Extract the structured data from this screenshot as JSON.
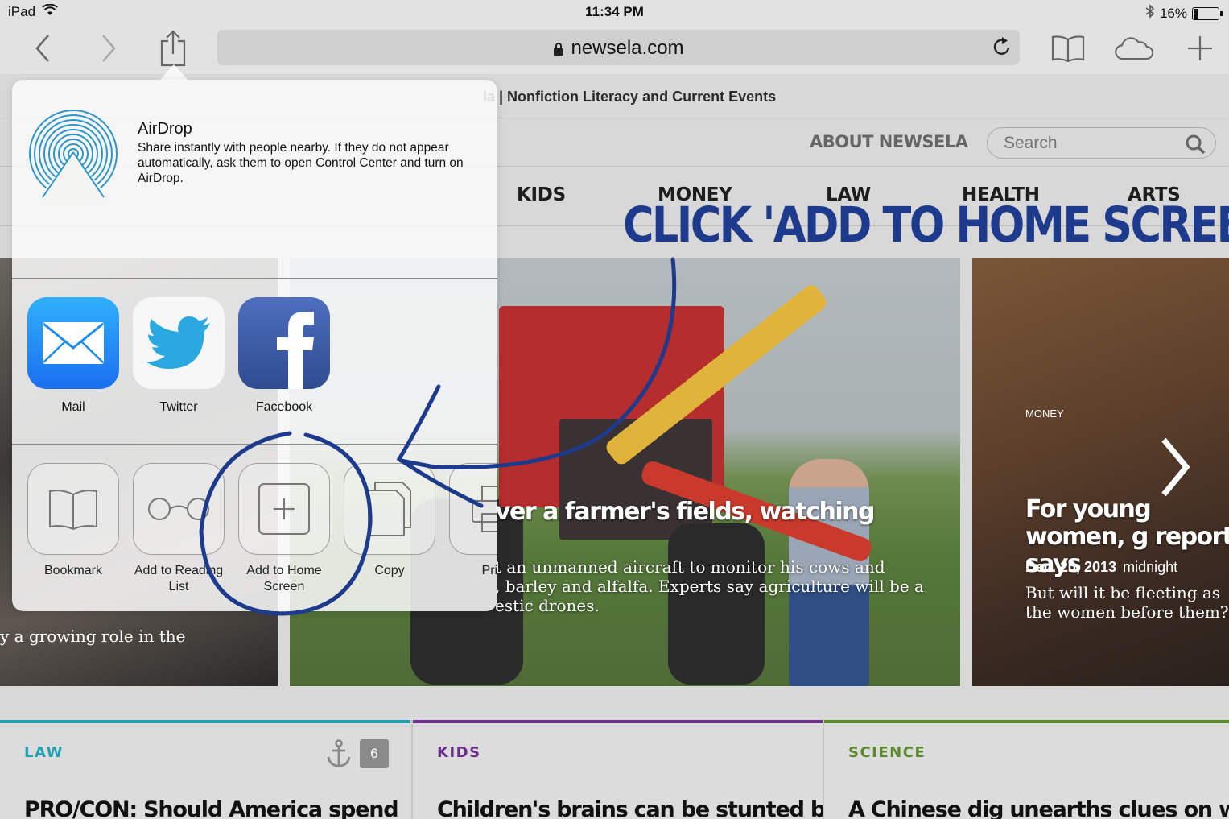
{
  "status_bar": {
    "device": "iPad",
    "time": "11:34 PM",
    "battery": "16%",
    "battery_level": 0.16
  },
  "browser": {
    "url": "newsela.com"
  },
  "page": {
    "title": "la | Nonfiction Literacy and Current Events",
    "about_link": "ABOUT NEWSELA",
    "search_placeholder": "Search",
    "nav": [
      "KIDS",
      "MONEY",
      "LAW",
      "HEALTH",
      "ARTS"
    ],
    "annotation": "CLICK 'ADD TO HOME SCREEN'",
    "hero_main": {
      "headline": "ver a farmer's fields, watching",
      "text_lines": [
        "t an unmanned aircraft to monitor his cows and",
        ", barley and alfalfa. Experts say agriculture will be a",
        "estic drones."
      ]
    },
    "hero_right": {
      "category": "MONEY",
      "headline": "For young women, g report says",
      "date": "Dec. 20, 2013",
      "time": "midnight",
      "text": "But will it be fleeting as the women before them?"
    },
    "hero_left_text": "y a growing role in the",
    "cards": [
      {
        "category": "LAW",
        "color": "#1fa3b2",
        "headline": "PRO/CON: Should America spend",
        "count": "6"
      },
      {
        "category": "KIDS",
        "color": "#6b2f8a",
        "headline": "Children's brains can be stunted by"
      },
      {
        "category": "SCIENCE",
        "color": "#5a8a2a",
        "headline": "A Chinese dig unearths clues on when"
      }
    ]
  },
  "share_sheet": {
    "airdrop_title": "AirDrop",
    "airdrop_desc": "Share instantly with people nearby. If they do not appear automatically, ask them to open Control Center and turn on AirDrop.",
    "apps": [
      {
        "label": "Mail",
        "icon": "mail-icon",
        "color": "#1a8cf0"
      },
      {
        "label": "Twitter",
        "icon": "twitter-icon",
        "color": "#2aa9e0"
      },
      {
        "label": "Facebook",
        "icon": "facebook-icon",
        "color": "#3b5998"
      }
    ],
    "actions": [
      {
        "label": "Bookmark",
        "icon": "book-icon"
      },
      {
        "label": "Add to Reading List",
        "icon": "glasses-icon"
      },
      {
        "label": "Add to Home Screen",
        "icon": "plus-square-icon"
      },
      {
        "label": "Copy",
        "icon": "copy-icon"
      },
      {
        "label": "Print",
        "icon": "print-icon"
      }
    ]
  }
}
